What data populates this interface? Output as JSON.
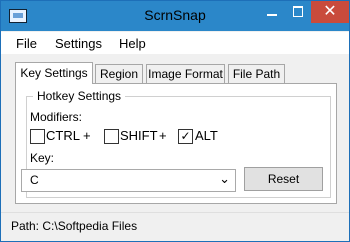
{
  "window": {
    "title": "ScrnSnap",
    "icon": "app-icon",
    "controls": [
      "minimize",
      "maximize",
      "close"
    ]
  },
  "menu": [
    "File",
    "Settings",
    "Help"
  ],
  "tabs": [
    "Key Settings",
    "Region",
    "Image Format",
    "File Path"
  ],
  "selected_tab": "Key Settings",
  "hotkey": {
    "group_title": "Hotkey Settings",
    "modifiers_label": "Modifiers:",
    "ctrl": {
      "label": "CTRL",
      "checked": false
    },
    "shift": {
      "label": "SHIFT",
      "checked": false
    },
    "alt": {
      "label": "ALT",
      "checked": true
    },
    "plus": "+",
    "key_label": "Key:",
    "key_value": "C",
    "reset_label": "Reset"
  },
  "status": {
    "path": "Path: C:\\Softpedia Files"
  },
  "colors": {
    "title_bar": "#2b87c9",
    "close_button": "#c94b3c",
    "window_bg": "#f0f0f0"
  }
}
